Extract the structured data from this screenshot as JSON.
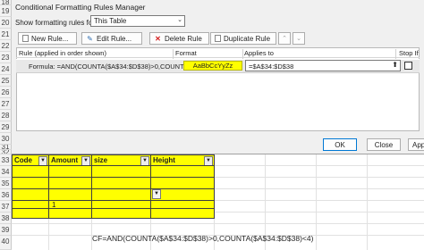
{
  "row_numbers_top": [
    "18",
    "19",
    "20",
    "21",
    "22",
    "23",
    "24",
    "25",
    "26",
    "27",
    "28",
    "29",
    "30",
    "31",
    "32"
  ],
  "row_numbers_bottom": [
    "33",
    "34",
    "35",
    "36",
    "37",
    "38",
    "39",
    "40"
  ],
  "dialog": {
    "title": "Conditional Formatting Rules Manager",
    "show_rules_label": "Show formatting rules for:",
    "show_rules_value": "This Table",
    "toolbar": {
      "new_rule": "New Rule...",
      "edit_rule": "Edit Rule...",
      "delete_rule": "Delete Rule",
      "duplicate_rule": "Duplicate Rule"
    },
    "columns": {
      "rule": "Rule (applied in order shown)",
      "format": "Format",
      "applies_to": "Applies to",
      "stop_if_true": "Stop If"
    },
    "rule": {
      "formula": "Formula: =AND(COUNTA($A$34:$D$38)>0,COUNT...",
      "format_preview": "AaBbCcYyZz",
      "applies_to": "=$A$34:$D$38",
      "format_color": "#ffff00"
    },
    "ok": "OK",
    "close": "Close",
    "apply": "Apply"
  },
  "table": {
    "headers": [
      "Code",
      "Amount",
      "size",
      "Height"
    ],
    "cell_value": "1",
    "fill_color": "#ffff00"
  },
  "formula_note": "CF=AND(COUNTA($A$34:$D$38)>0,COUNTA($A$34:$D$38)<4)"
}
